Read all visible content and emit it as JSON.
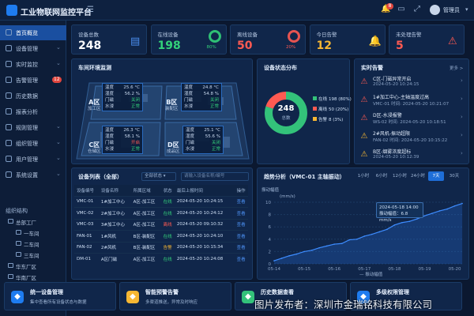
{
  "app": {
    "title": "工业物联网监控平台",
    "user": "管理员",
    "notif_count": "8"
  },
  "sidebar": {
    "items": [
      {
        "label": "首页概览",
        "active": true
      },
      {
        "label": "设备管理"
      },
      {
        "label": "实时监控"
      },
      {
        "label": "告警管理",
        "badge": "12"
      },
      {
        "label": "历史数据"
      },
      {
        "label": "报表分析"
      },
      {
        "label": "规则管理"
      },
      {
        "label": "组织管理"
      },
      {
        "label": "用户管理"
      },
      {
        "label": "系统设置"
      }
    ],
    "org_title": "组织结构",
    "tree": [
      "总部工厂",
      "一车间",
      "二车间",
      "三车间",
      "华东厂区",
      "华南厂区"
    ]
  },
  "stats": [
    {
      "label": "设备总数",
      "value": "248",
      "color": "#ffffff"
    },
    {
      "label": "在线设备",
      "value": "198",
      "color": "#33d17a",
      "pct": "80%"
    },
    {
      "label": "离线设备",
      "value": "50",
      "color": "#ff5a52",
      "pct": "20%"
    },
    {
      "label": "今日告警",
      "value": "12",
      "color": "#f7b733"
    },
    {
      "label": "未处理告警",
      "value": "5",
      "color": "#ff5a52"
    }
  ],
  "env": {
    "title": "车间环境监测",
    "zones": [
      {
        "name": "A区",
        "sub": "加工区"
      },
      {
        "name": "B区",
        "sub": "装配区"
      },
      {
        "name": "C区",
        "sub": "仓储区"
      },
      {
        "name": "D区",
        "sub": "成品区"
      }
    ],
    "boxes": [
      {
        "rows": [
          [
            "温度",
            "25.6 °C"
          ],
          [
            "湿度",
            "56.2 %"
          ],
          [
            "门磁",
            "关闭"
          ],
          [
            "水浸",
            "正常"
          ]
        ]
      },
      {
        "rows": [
          [
            "温度",
            "24.8 °C"
          ],
          [
            "湿度",
            "54.8 %"
          ],
          [
            "门磁",
            "关闭"
          ],
          [
            "水浸",
            "正常"
          ]
        ]
      },
      {
        "rows": [
          [
            "温度",
            "26.3 °C"
          ],
          [
            "湿度",
            "58.1 %"
          ],
          [
            "门磁",
            "开启"
          ],
          [
            "水浸",
            "正常"
          ]
        ]
      },
      {
        "rows": [
          [
            "温度",
            "25.1 °C"
          ],
          [
            "湿度",
            "55.6 %"
          ],
          [
            "门磁",
            "关闭"
          ],
          [
            "水浸",
            "正常"
          ]
        ]
      }
    ]
  },
  "status_chart": {
    "title": "设备状态分布",
    "total": "248",
    "total_label": "总数",
    "legend": [
      {
        "label": "在线",
        "value": "198 (80%)",
        "color": "#33c27a"
      },
      {
        "label": "离线",
        "value": "50 (20%)",
        "color": "#ff5a52"
      },
      {
        "label": "告警",
        "value": "8 (3%)",
        "color": "#f7b733"
      }
    ]
  },
  "alarms": {
    "title": "实时告警",
    "more": "更多 >",
    "items": [
      {
        "title": "C区-门磁异常开启",
        "meta": "2024-05-20 10:24:15",
        "color": "#ff5a52",
        "icon": "warning"
      },
      {
        "title": "1#加工中心-主轴温度过高",
        "meta": "VMC-01   时间: 2024-05-20 10:21:07",
        "color": "#ff5a52",
        "icon": "warning"
      },
      {
        "title": "D区-水浸报警",
        "meta": "WS-02   时间: 2024-05-20 10:18:51",
        "color": "#ff5a52",
        "icon": "warning"
      },
      {
        "title": "2#风机-振动超限",
        "meta": "FAN-02   时间: 2024-05-20 10:15:22",
        "color": "#f7b733",
        "icon": "warning"
      },
      {
        "title": "B区-烟雾浓度超标",
        "meta": "2024-05-20 10:12:39",
        "color": "#f7b733",
        "icon": "warning"
      }
    ]
  },
  "device_list": {
    "title": "设备列表（全部）",
    "filter": "全部状态",
    "search_placeholder": "请输入设备名称/编号",
    "headers": [
      "设备编号",
      "设备名称",
      "所属区域",
      "状态",
      "最后上报时间",
      "操作"
    ],
    "rows": [
      [
        "VMC-01",
        "1#加工中心",
        "A区-加工区",
        "在线",
        "2024-05-20 10:24:15",
        "查看"
      ],
      [
        "VMC-02",
        "2#加工中心",
        "A区-加工区",
        "在线",
        "2024-05-20 10:24:12",
        "查看"
      ],
      [
        "VMC-03",
        "3#加工中心",
        "A区-加工区",
        "离线",
        "2024-05-20 09:10:32",
        "查看"
      ],
      [
        "FAN-01",
        "1#风机",
        "B区-装配区",
        "在线",
        "2024-05-20 10:24:10",
        "查看"
      ],
      [
        "FAN-02",
        "2#风机",
        "B区-装配区",
        "告警",
        "2024-05-20 10:15:34",
        "查看"
      ],
      [
        "DM-01",
        "A区门磁",
        "A区-加工区",
        "在线",
        "2024-05-20 10:24:08",
        "查看"
      ]
    ],
    "status_colors": {
      "在线": "#33d17a",
      "离线": "#ff5a52",
      "告警": "#f7b733"
    }
  },
  "trend": {
    "title": "趋势分析（VMC-01 主轴振动）",
    "tabs": [
      "1小时",
      "6小时",
      "12小时",
      "24小时",
      "7天",
      "30天"
    ],
    "selected_tab": "7天",
    "y_title": "振动幅值",
    "unit": "(mm/s)",
    "legend": "振动幅值",
    "tooltip_time": "2024-05-18 14:00",
    "tooltip_value": "振动幅值：6.8 mm/s"
  },
  "chart_data": {
    "type": "line",
    "xlabel": "",
    "ylabel": "振动幅值",
    "ylim": [
      0,
      10
    ],
    "yticks": [
      0,
      2,
      4,
      6,
      8,
      10
    ],
    "xticks": [
      "05-14",
      "05-15",
      "05-16",
      "05-17",
      "05-18",
      "05-19",
      "05-20"
    ],
    "series": [
      {
        "name": "振动幅值",
        "x": [
          0,
          0.25,
          0.5,
          0.75,
          1,
          1.25,
          1.5,
          1.75,
          2,
          2.25,
          2.5,
          2.75,
          3,
          3.25,
          3.5,
          3.75,
          4,
          4.25,
          4.5,
          4.75,
          5,
          5.25,
          5.5,
          5.75,
          6,
          6.25
        ],
        "y": [
          0.5,
          0.9,
          1.3,
          1.6,
          2.0,
          2.2,
          2.6,
          2.9,
          3.2,
          3.3,
          3.9,
          4.0,
          4.5,
          4.8,
          5.2,
          5.6,
          6.3,
          6.7,
          6.9,
          7.3,
          7.8,
          8.2,
          8.6,
          8.9,
          9.4,
          9.8
        ]
      }
    ]
  },
  "features": [
    {
      "title": "统一设备管理",
      "desc": "集中查看所有设备状态与数据",
      "color": "#1e7cf0"
    },
    {
      "title": "智能预警告警",
      "desc": "多渠道推送，异常及时响应",
      "color": "#f7b733"
    },
    {
      "title": "历史数据查看",
      "desc": "",
      "color": "#33c27a"
    },
    {
      "title": "多级权限管理",
      "desc": "",
      "color": "#1e7cf0"
    }
  ],
  "watermark": "图片发布者：深圳市金瑞铭科技有限公司"
}
